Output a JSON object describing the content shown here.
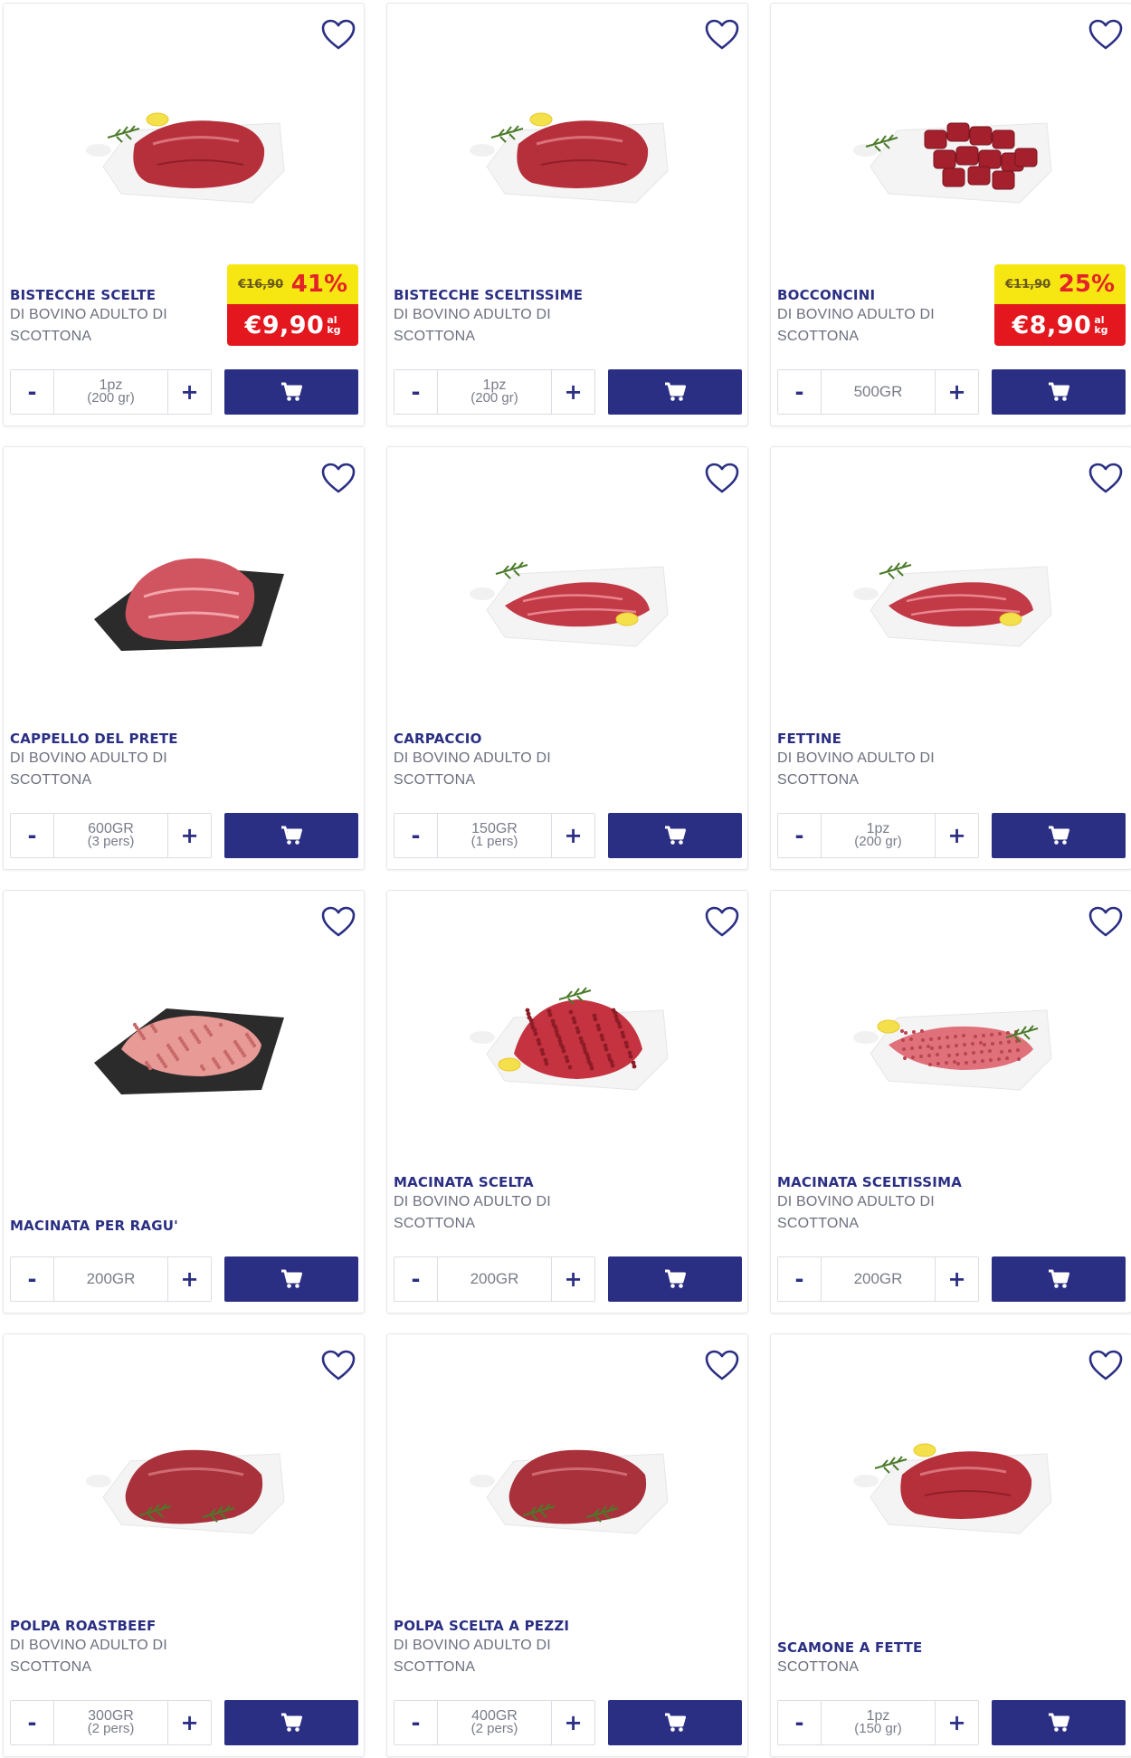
{
  "products": [
    {
      "name": "BISTECCHE SCELTE",
      "sub1": "DI BOVINO ADULTO DI",
      "sub2": "SCOTTONA",
      "promo": {
        "old_price": "€16,90",
        "discount": "41%",
        "price": "€9,90",
        "unit_top": "al",
        "unit_bottom": "kg"
      },
      "qty_main": "1pz",
      "qty_sub": "(200 gr)",
      "image": "steak-on-board"
    },
    {
      "name": "BISTECCHE SCELTISSIME",
      "sub1": "DI BOVINO ADULTO DI",
      "sub2": "SCOTTONA",
      "qty_main": "1pz",
      "qty_sub": "(200 gr)",
      "image": "steak-on-board"
    },
    {
      "name": "BOCCONCINI",
      "sub1": "DI BOVINO ADULTO DI",
      "sub2": "SCOTTONA",
      "promo": {
        "old_price": "€11,90",
        "discount": "25%",
        "price": "€8,90",
        "unit_top": "al",
        "unit_bottom": "kg"
      },
      "qty_main": "500GR",
      "qty_sub": "",
      "image": "meat-cubes"
    },
    {
      "name": "CAPPELLO DEL PRETE",
      "sub1": "DI BOVINO ADULTO DI",
      "sub2": "SCOTTONA",
      "qty_main": "600GR",
      "qty_sub": "(3 pers)",
      "image": "roast-on-slate"
    },
    {
      "name": "CARPACCIO",
      "sub1": "DI BOVINO ADULTO DI",
      "sub2": "SCOTTONA",
      "qty_main": "150GR",
      "qty_sub": "(1 pers)",
      "image": "thin-slices"
    },
    {
      "name": "FETTINE",
      "sub1": "DI BOVINO ADULTO DI",
      "sub2": "SCOTTONA",
      "qty_main": "1pz",
      "qty_sub": "(200 gr)",
      "image": "thin-slices"
    },
    {
      "name": "MACINATA PER RAGU'",
      "sub1": "",
      "sub2": "",
      "qty_main": "200GR",
      "qty_sub": "",
      "image": "mince-on-slate"
    },
    {
      "name": "MACINATA SCELTA",
      "sub1": "DI BOVINO ADULTO DI",
      "sub2": "SCOTTONA",
      "qty_main": "200GR",
      "qty_sub": "",
      "image": "mince-mound"
    },
    {
      "name": "MACINATA SCELTISSIMA",
      "sub1": "DI BOVINO ADULTO DI",
      "sub2": "SCOTTONA",
      "qty_main": "200GR",
      "qty_sub": "",
      "image": "mince-flat"
    },
    {
      "name": "POLPA ROASTBEEF",
      "sub1": "DI BOVINO ADULTO DI",
      "sub2": "SCOTTONA",
      "qty_main": "300GR",
      "qty_sub": "(2 pers)",
      "image": "roast-on-board"
    },
    {
      "name": "POLPA SCELTA A PEZZI",
      "sub1": "DI BOVINO ADULTO DI",
      "sub2": "SCOTTONA",
      "qty_main": "400GR",
      "qty_sub": "(2 pers)",
      "image": "roast-on-board"
    },
    {
      "name": "SCAMONE A FETTE",
      "sub1": "SCOTTONA",
      "sub2": "",
      "qty_main": "1pz",
      "qty_sub": "(150 gr)",
      "image": "steak-on-board"
    }
  ],
  "controls": {
    "minus": "-",
    "plus": "+"
  },
  "icons": {
    "wishlist": "heart-outline-icon",
    "cart": "shopping-cart-icon"
  },
  "colors": {
    "brand": "#2b2f83",
    "promo_yellow": "#f6e612",
    "promo_red": "#e4161e"
  }
}
